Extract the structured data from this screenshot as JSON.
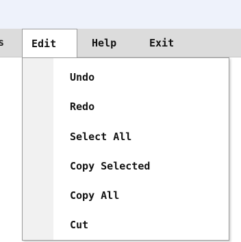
{
  "menubar": {
    "partial_label": "s",
    "items": [
      {
        "label": "Edit"
      },
      {
        "label": "Help"
      },
      {
        "label": "Exit"
      }
    ]
  },
  "edit_menu": {
    "items": [
      {
        "label": "Undo"
      },
      {
        "label": "Redo"
      },
      {
        "label": "Select All"
      },
      {
        "label": "Copy Selected"
      },
      {
        "label": "Copy All"
      },
      {
        "label": "Cut"
      }
    ]
  }
}
